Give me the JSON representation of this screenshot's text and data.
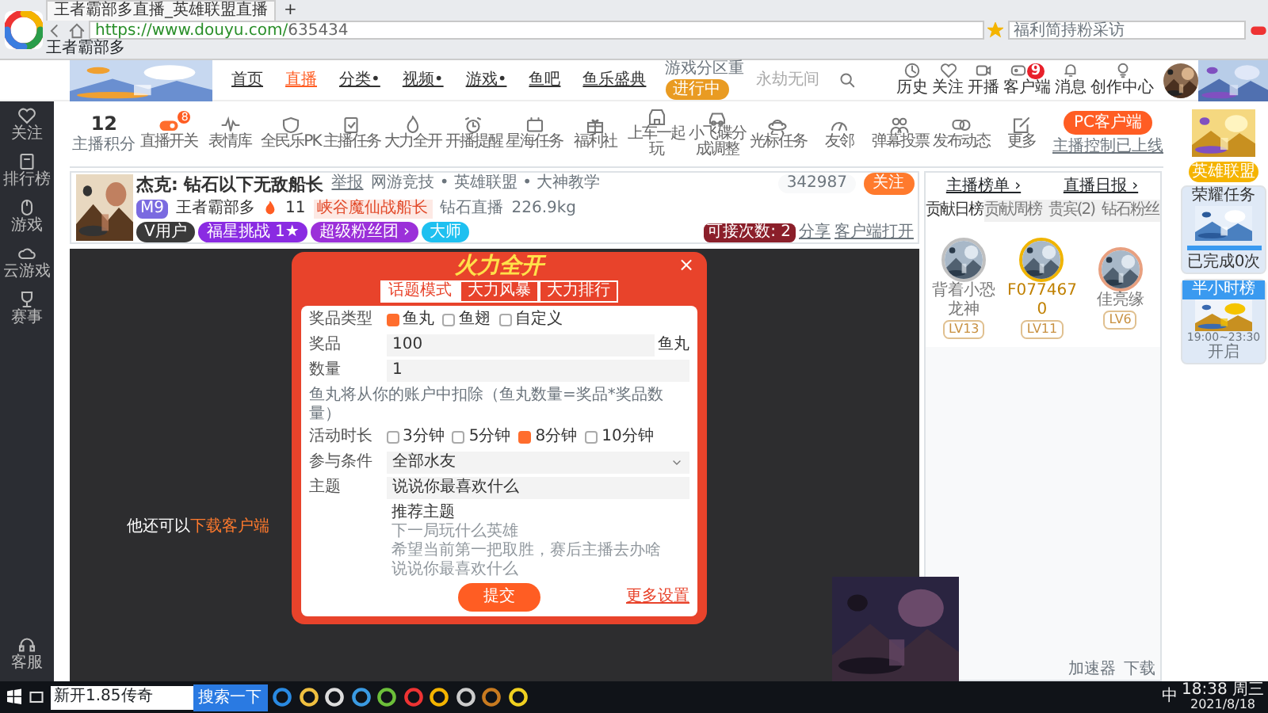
{
  "browser": {
    "tab_title": "王者霸部多直播_英雄联盟直播",
    "new_tab": "+",
    "url_host": "https://www.douyu.com/",
    "url_path": "635434",
    "search_placeholder": "福利简持粉采访",
    "bookmark": "王者霸部多"
  },
  "site_header": {
    "nav": [
      {
        "label": "首页",
        "selected": false
      },
      {
        "label": "直播",
        "selected": true
      },
      {
        "label": "分类•",
        "selected": false
      },
      {
        "label": "视频•",
        "selected": false
      },
      {
        "label": "游戏•",
        "selected": false
      },
      {
        "label": "鱼吧",
        "selected": false
      },
      {
        "label": "鱼乐盛典",
        "selected": false
      }
    ],
    "promo": {
      "title": "游戏分区重",
      "button": "进行中"
    },
    "search_placeholder": "永劫无间",
    "actions": [
      {
        "label": "历史"
      },
      {
        "label": "关注"
      },
      {
        "label": "开播"
      },
      {
        "label": "客户端",
        "badge": "9"
      },
      {
        "label": "消息"
      },
      {
        "label": "创作中心"
      }
    ]
  },
  "sidebar": {
    "items": [
      {
        "label": "关注"
      },
      {
        "label": "排行榜"
      },
      {
        "label": "游戏"
      },
      {
        "label": "云游戏"
      },
      {
        "label": "赛事"
      }
    ],
    "bottom": "客服"
  },
  "toolbar": {
    "score": "12",
    "score_label": "主播积分",
    "items": [
      {
        "label": "直播开关",
        "badge": "8"
      },
      {
        "label": "表情库"
      },
      {
        "label": "全民乐PK"
      },
      {
        "label": "主播任务"
      },
      {
        "label": "大力全开"
      },
      {
        "label": "开播提醒"
      },
      {
        "label": "星海任务"
      },
      {
        "label": "福利社"
      },
      {
        "label": "上车一起玩"
      },
      {
        "label": "小飞碟分成调整"
      },
      {
        "label": "光标任务"
      },
      {
        "label": "友邻"
      },
      {
        "label": "弹幕投票"
      },
      {
        "label": "发布动态"
      },
      {
        "label": "更多"
      }
    ],
    "client_button": "PC客户端",
    "client_note": "主播控制已上线"
  },
  "streamer": {
    "title": "杰克: 钻石以下无敌船长",
    "report": "举报",
    "category": "网游竞技 • 英雄联盟 • 大神教学",
    "level": "M9",
    "name": "王者霸部多",
    "heat": "11",
    "tag": "峡谷魔仙战船长",
    "rank": "钻石直播",
    "weight": "226.9kg",
    "chips": [
      {
        "label": "V用户",
        "color": "#3a3a3a"
      },
      {
        "label": "福星挑战 1★",
        "color": "#8a2be2"
      },
      {
        "label": "超级粉丝团 ›",
        "color": "#9b30d9"
      },
      {
        "label": "大师",
        "color": "#1ec0f0"
      }
    ],
    "follow_count": "342987",
    "follow": "关注",
    "quota": "可接次数: 2",
    "share": "分享",
    "open_client": "客户端打开"
  },
  "video": {
    "notice": "他还可以",
    "notice_link": "下载客户端"
  },
  "modal": {
    "banner": "火力全开",
    "close": "×",
    "tabs": [
      {
        "label": "话题模式",
        "selected": true
      },
      {
        "label": "大力风暴",
        "selected": false
      },
      {
        "label": "大力排行",
        "selected": false
      }
    ],
    "prize_type": {
      "label": "奖品类型",
      "options": [
        {
          "label": "鱼丸",
          "checked": true
        },
        {
          "label": "鱼翅",
          "checked": false
        },
        {
          "label": "自定义",
          "checked": false
        }
      ]
    },
    "prize": {
      "label": "奖品",
      "value": "100",
      "unit": "鱼丸"
    },
    "quantity": {
      "label": "数量",
      "value": "1"
    },
    "note": "鱼丸将从你的账户中扣除（鱼丸数量=奖品*奖品数量）",
    "duration": {
      "label": "活动时长",
      "options": [
        {
          "label": "3分钟",
          "checked": false
        },
        {
          "label": "5分钟",
          "checked": false
        },
        {
          "label": "8分钟",
          "checked": true
        },
        {
          "label": "10分钟",
          "checked": false
        }
      ]
    },
    "condition": {
      "label": "参与条件",
      "value": "全部水友"
    },
    "topic": {
      "label": "主题",
      "value": "说说你最喜欢什么"
    },
    "suggestions": {
      "title": "推荐主题",
      "items": [
        "下一局玩什么英雄",
        "希望当前第一把取胜，赛后主播去办啥",
        "说说你最喜欢什么"
      ]
    },
    "submit": "提交",
    "more": "更多设置"
  },
  "player_bar": [
    "加速器",
    "下载"
  ],
  "right_panel": {
    "links": [
      "主播榜单 ›",
      "直播日报 ›"
    ],
    "tabs": [
      {
        "label": "贡献日榜",
        "selected": true
      },
      {
        "label": "贡献周榜",
        "selected": false
      },
      {
        "label": "贵宾(2)",
        "selected": false
      },
      {
        "label": "钻石粉丝",
        "selected": false
      }
    ],
    "top3": [
      {
        "name": "背着小恐龙神",
        "level": "LV13",
        "color": "#c0c0c0"
      },
      {
        "name": "F0774670",
        "level": "LV11",
        "color": "#f0b400"
      },
      {
        "name": "佳亮缘",
        "level": "LV6",
        "color": "#e8a080"
      }
    ]
  },
  "promo_column": {
    "label": "英雄联盟",
    "task": "荣耀任务",
    "level": 1.0,
    "progress": "已完成0次",
    "rank": "半小时榜",
    "hours": "19:00~23:30",
    "open": "开启"
  },
  "taskbar": {
    "search_value": "新开1.85传奇",
    "search_button": "搜索一下",
    "ime": "中",
    "time": "18:38 周三",
    "date": "2021/8/18"
  }
}
